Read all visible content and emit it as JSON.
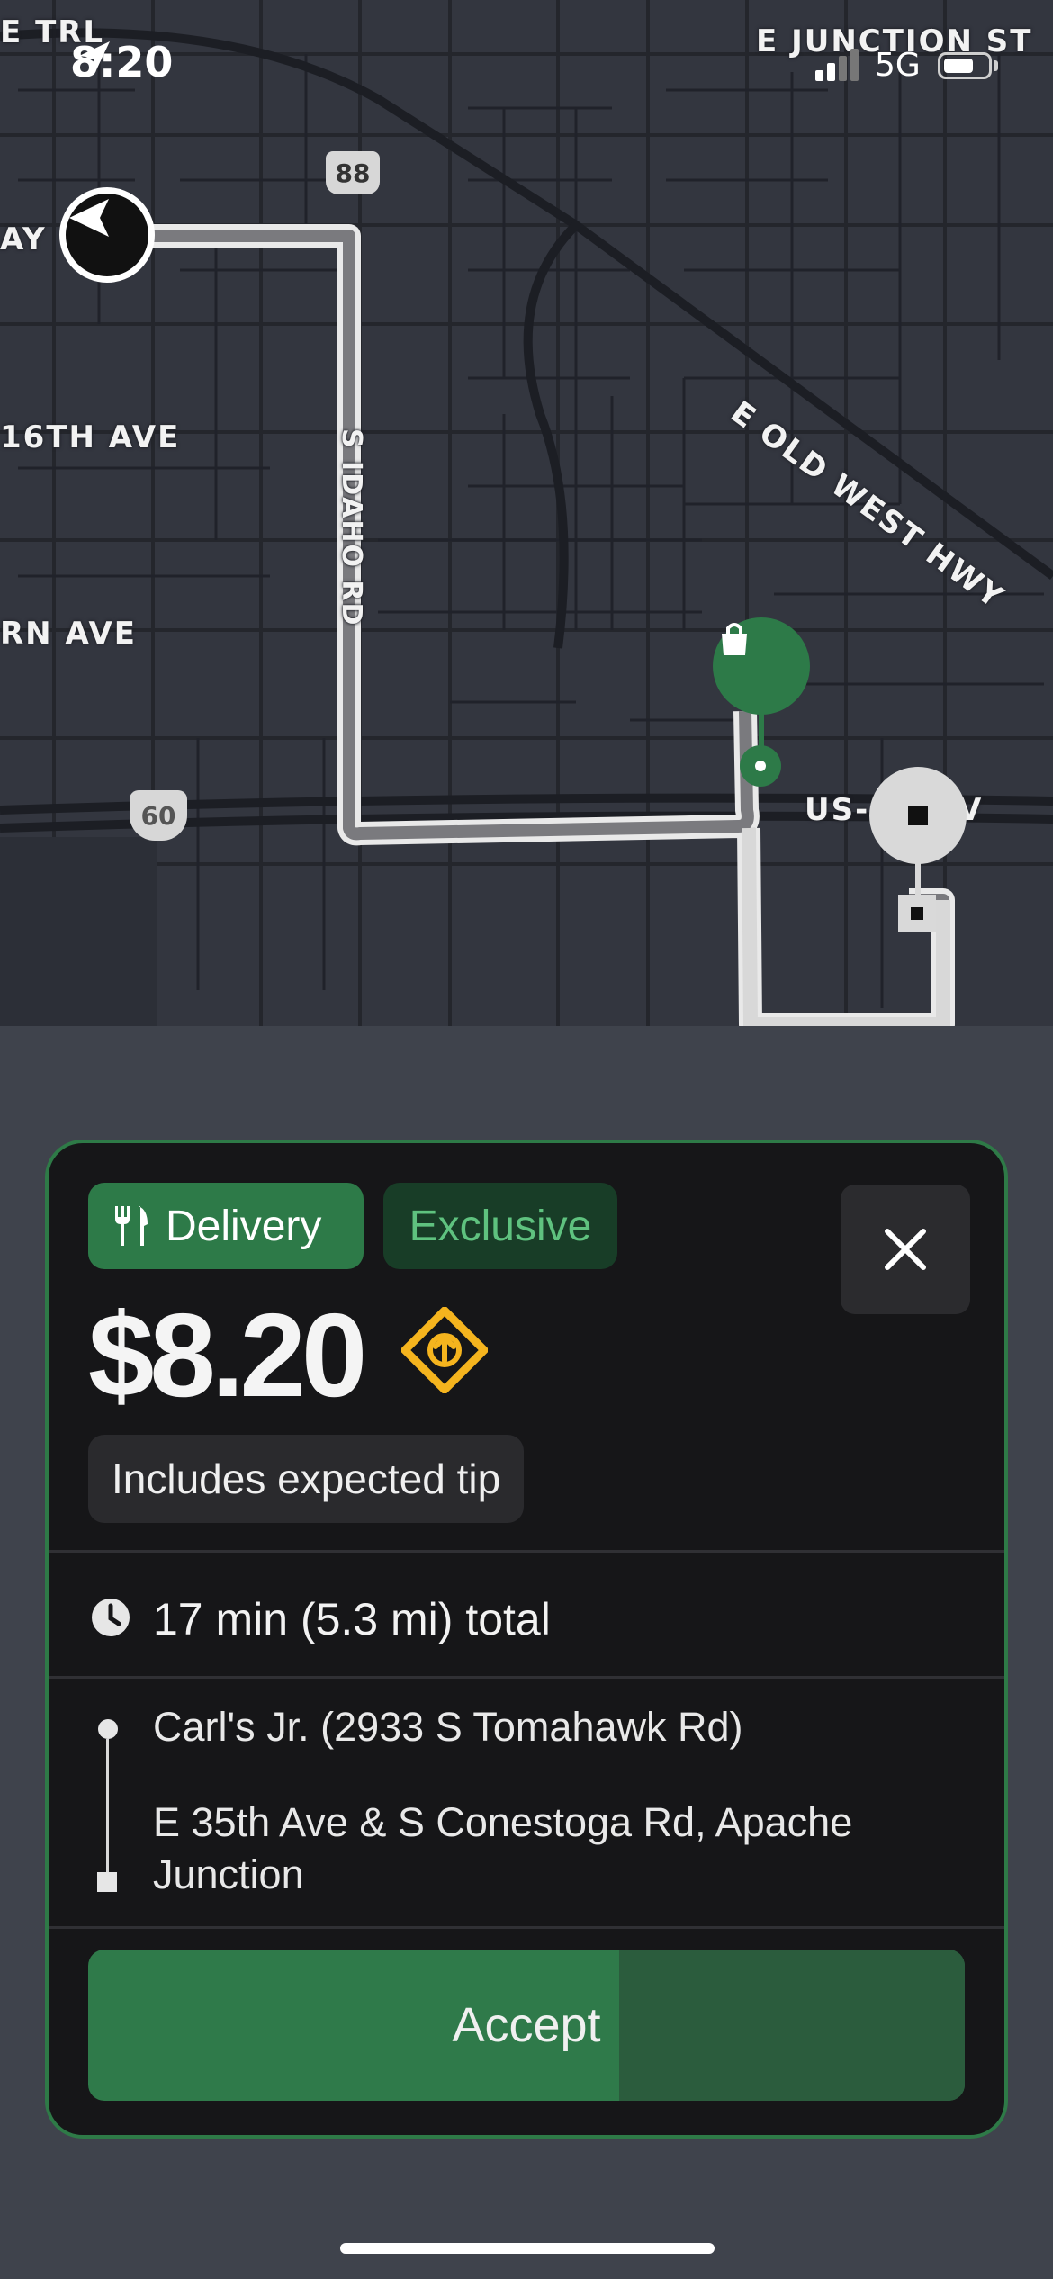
{
  "status_bar": {
    "time": "8:20",
    "network": "5G"
  },
  "map": {
    "labels": {
      "trail": "E TRL",
      "junction": "E JUNCTION ST",
      "way": "AY",
      "ave16": "16TH AVE",
      "rnave": "RN AVE",
      "idaho": "S IDAHO RD",
      "oldwest": "E OLD WEST HWY",
      "us60": "US-",
      "us60b": "V"
    },
    "shields": {
      "route88": "88",
      "route60": "60"
    }
  },
  "offer": {
    "delivery_label": "Delivery",
    "exclusive_label": "Exclusive",
    "price": "$8.20",
    "tip_note": "Includes expected tip",
    "total": "17 min (5.3 mi) total",
    "pickup": "Carl's Jr. (2933 S Tomahawk Rd)",
    "dropoff_line1": "E 35th Ave & S Conestoga Rd, Apache",
    "dropoff_line2": "Junction",
    "accept_label": "Accept"
  },
  "colors": {
    "accent_green": "#2d7a48",
    "boost_yellow": "#f5b41e",
    "card_bg": "#161618"
  },
  "icons": [
    "location-arrow-icon",
    "fork-knife-icon",
    "close-icon",
    "boost-icon",
    "clock-icon",
    "shopping-bag-icon",
    "navigation-arrow-icon"
  ]
}
